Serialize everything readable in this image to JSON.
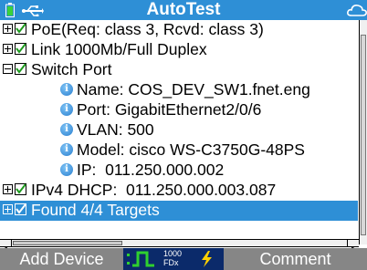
{
  "title": "AutoTest",
  "icons": {
    "battery": "battery-icon",
    "usb": "usb-icon",
    "cloud": "cloud-icon",
    "checkmark": "checkmark-icon",
    "info": "info-icon",
    "flash": "flash-icon",
    "link_pulse": "link-pulse-icon"
  },
  "colors": {
    "titlebar": "#2e8fd6",
    "selection": "#2e8fd6",
    "softbar": "#868686",
    "linkbox": "#0b2a6a",
    "check_green": "#1e9a1e",
    "flash_yellow": "#ffd000"
  },
  "tree": {
    "items": [
      {
        "label": "PoE(Req: class 3, Rcvd: class 3)"
      },
      {
        "label": "Link 1000Mb/Full Duplex"
      },
      {
        "label": "Switch Port"
      },
      {
        "label": "Name: COS_DEV_SW1.fnet.eng"
      },
      {
        "label": "Port: GigabitEthernet2/0/6"
      },
      {
        "label": "VLAN: 500"
      },
      {
        "label": "Model: cisco WS-C3750G-48PS"
      },
      {
        "label": "IP:  011.250.000.002"
      },
      {
        "label": "IPv4 DHCP:  011.250.000.003.087"
      },
      {
        "label": "Found 4/4 Targets"
      }
    ]
  },
  "softkeys": {
    "left": "Add Device",
    "right": "Comment",
    "link_speed": "1000",
    "link_duplex": "FDx"
  }
}
